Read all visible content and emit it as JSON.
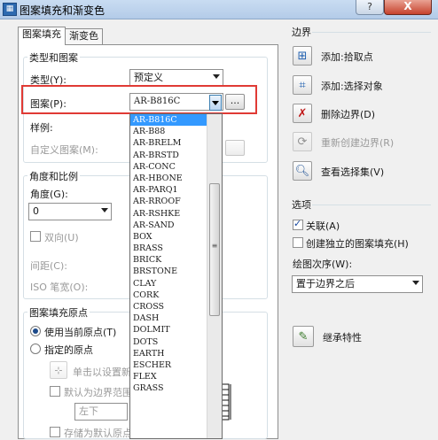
{
  "window": {
    "title": "图案填充和渐变色",
    "help_label": "?",
    "close_label": "X"
  },
  "tabs": [
    {
      "label": "图案填充"
    },
    {
      "label": "渐变色"
    }
  ],
  "type_pattern": {
    "group_title": "类型和图案",
    "type_label": "类型(Y):",
    "type_value": "预定义",
    "pattern_label": "图案(P):",
    "pattern_value": "AR-B816C",
    "ellipsis_label": "...",
    "swatch_label": "样例:",
    "custom_label": "自定义图案(M):"
  },
  "angle_scale": {
    "group_title": "角度和比例",
    "angle_label": "角度(G):",
    "angle_value": "0",
    "bidirectional_label": "双向(U)",
    "spacing_label": "间距(C):",
    "iso_label": "ISO 笔宽(O):"
  },
  "origin": {
    "group_title": "图案填充原点",
    "use_current_label": "使用当前原点(T)",
    "specified_label": "指定的原点",
    "click_set_label": "单击以设置新原点",
    "default_extent_label": "默认为边界范围(X)",
    "position_value": "左下",
    "store_default_label": "存储为默认原点(F)"
  },
  "pattern_list": {
    "items": [
      "AR-B816C",
      "AR-B88",
      "AR-BRELM",
      "AR-BRSTD",
      "AR-CONC",
      "AR-HBONE",
      "AR-PARQ1",
      "AR-RROOF",
      "AR-RSHKE",
      "AR-SAND",
      "BOX",
      "BRASS",
      "BRICK",
      "BRSTONE",
      "CLAY",
      "CORK",
      "CROSS",
      "DASH",
      "DOLMIT",
      "DOTS",
      "EARTH",
      "ESCHER",
      "FLEX",
      "GRASS"
    ],
    "selected": "AR-B816C",
    "scroll_mark": "≡"
  },
  "boundary": {
    "group_title": "边界",
    "add_pick_label": "添加:拾取点",
    "add_select_label": "添加:选择对象",
    "remove_label": "删除边界(D)",
    "recreate_label": "重新创建边界(R)",
    "view_selection_label": "查看选择集(V)"
  },
  "options": {
    "group_title": "选项",
    "associative_label": "关联(A)",
    "associative_checked": true,
    "independent_label": "创建独立的图案填充(H)",
    "draw_order_label": "绘图次序(W):",
    "draw_order_value": "置于边界之后"
  },
  "inherit": {
    "label": "继承特性"
  },
  "icons": [
    "pick-point-icon",
    "select-objects-icon",
    "remove-boundary-icon",
    "recreate-boundary-icon",
    "view-selection-icon",
    "inherit-properties-icon",
    "hatch-dialog-icon"
  ],
  "colors": {
    "title_bar": "#b8cfea",
    "highlight_border": "#e03a35",
    "list_selection": "#3399ff"
  }
}
